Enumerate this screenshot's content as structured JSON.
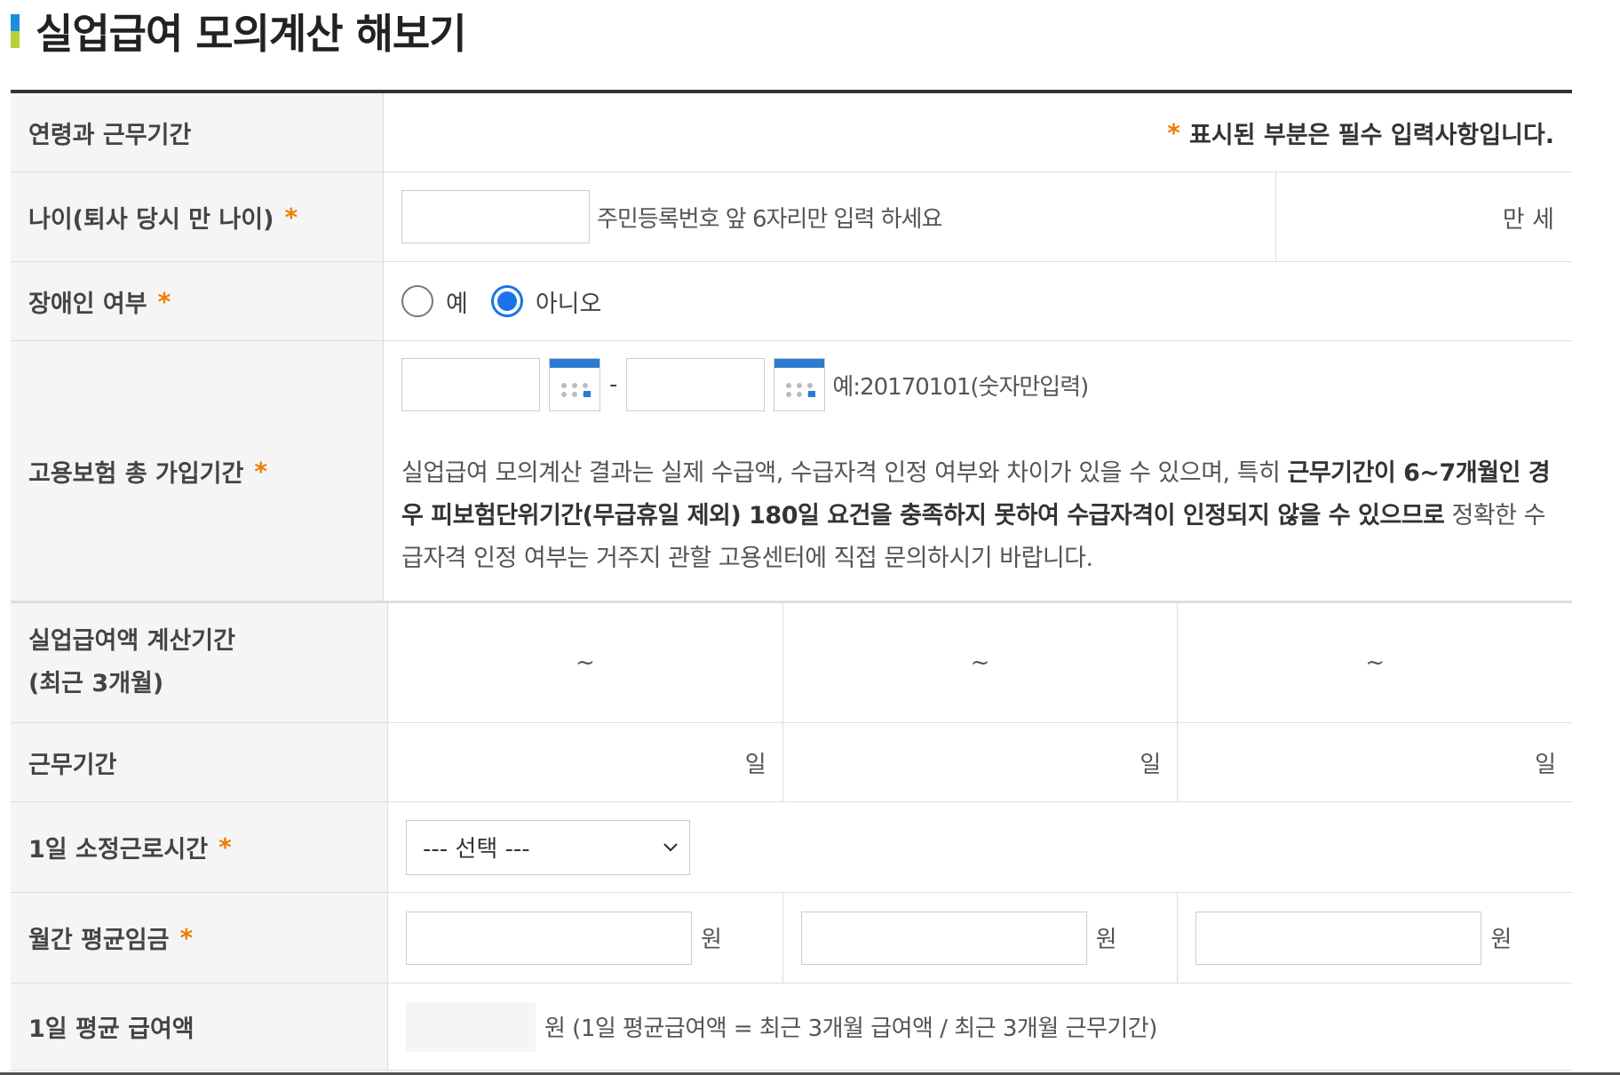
{
  "title": "실업급여 모의계산 해보기",
  "colors": {
    "accent": "#1a73e8",
    "required": "#f07c00",
    "title_mark_top": "#1a8fe0",
    "title_mark_bottom": "#b5d334"
  },
  "header_row": {
    "label": "연령과 근무기간",
    "required_star": "*",
    "required_note": "표시된 부분은 필수 입력사항입니다."
  },
  "age": {
    "label": "나이(퇴사 당시 만 나이)",
    "star": "*",
    "value": "",
    "hint": "주민등록번호 앞 6자리만 입력 하세요",
    "unit": "만 세"
  },
  "disability": {
    "label": "장애인 여부",
    "star": "*",
    "options": [
      {
        "label": "예",
        "checked": false
      },
      {
        "label": "아니오",
        "checked": true
      }
    ]
  },
  "insurance": {
    "label": "고용보험 총 가입기간",
    "star": "*",
    "start_value": "",
    "end_value": "",
    "dash": "-",
    "date_hint": "예:20170101(숫자만입력)",
    "notice_part1": "실업급여 모의계산 결과는 실제 수급액, 수급자격 인정 여부와 차이가 있을 수 있으며, 특히 ",
    "notice_bold": "근무기간이 6~7개월인 경우 피보험단위기간(무급휴일 제외) 180일 요건을 충족하지 못하여 수급자격이 인정되지 않을 수 있으므로",
    "notice_part2": " 정확한 수급자격 인정 여부는 거주지 관할 고용센터에 직접 문의하시기 바랍니다."
  },
  "calc_period": {
    "label_line1": "실업급여액 계산기간",
    "label_line2": "(최근 3개월)",
    "periods": [
      "~",
      "~",
      "~"
    ]
  },
  "work_period": {
    "label": "근무기간",
    "units": [
      "일",
      "일",
      "일"
    ]
  },
  "hours": {
    "label": "1일 소정근로시간",
    "star": "*",
    "selected": "--- 선택 ---"
  },
  "wage": {
    "label": "월간 평균임금",
    "star": "*",
    "unit": "원",
    "values": [
      "",
      "",
      ""
    ]
  },
  "avg_pay": {
    "label": "1일 평균 급여액",
    "value": "",
    "formula": "원 (1일 평균급여액 = 최근 3개월 급여액 / 최근 3개월 근무기간)"
  }
}
